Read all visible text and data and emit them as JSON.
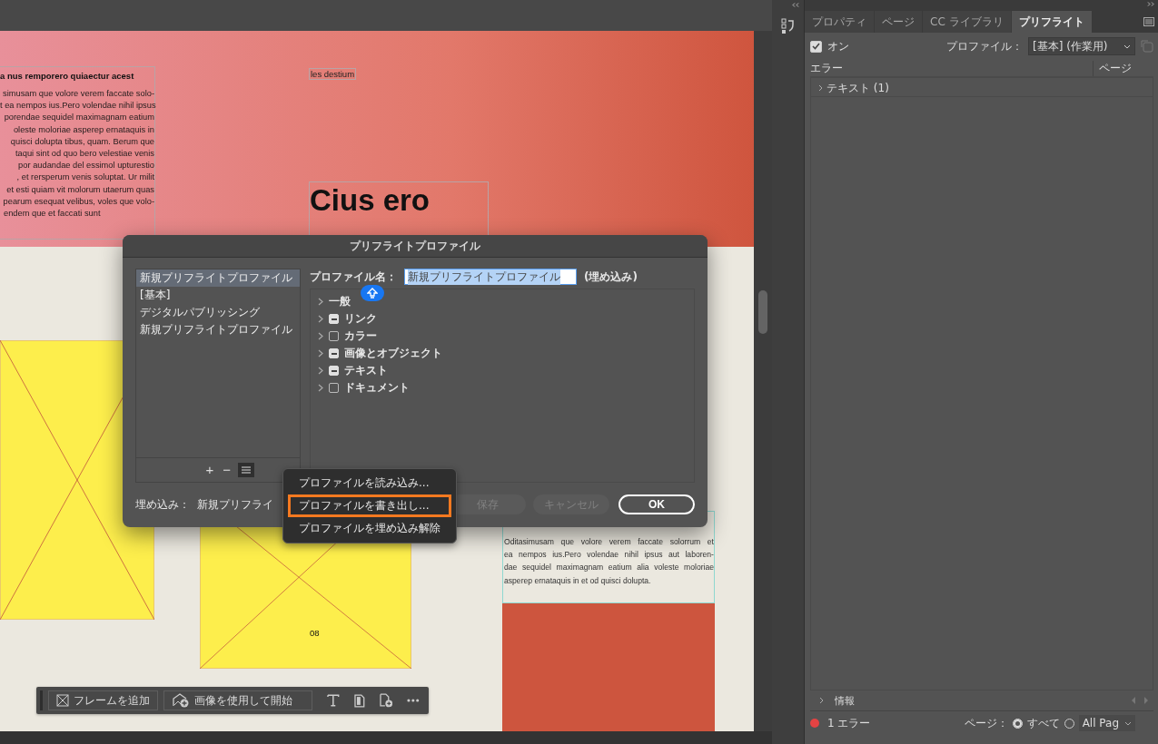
{
  "document": {
    "left_frame": {
      "heading": "a nus remporero quiaectur acest",
      "lines": [
        "simusam que volore verem faccate solo-",
        "t ea nempos ius.Pero volendae nihil ipsus",
        "porendae sequidel maximagnam eatium",
        "oleste moloriae asperep ernataquis in",
        "quisci dolupta tibus, quam. Berum que",
        "taqui sint od quo bero velestiae venis",
        "por audandae del essimol upturestio",
        ", et rersperum venis soluptat. Ur milit",
        "et esti quiam vit molorum utaerum quas",
        "pearum esequat velibus, voles que volo-",
        "endem que et faccati sunt"
      ]
    },
    "small_text": "les destium",
    "headline": "Cius ero",
    "page_number": "08",
    "right_frame": {
      "lines": [
        "Oditasimusam que volore verem faccate solorrum et",
        "ea nempos ius.Pero volendae nihil ipsus aut laboren-",
        "dae sequidel maximagnam eatium alia voleste moloriae",
        "asperep ernataquis in et od quisci dolupta."
      ]
    }
  },
  "toolbar": {
    "buttons": [
      {
        "kind": "frame",
        "label": "フレームを追加"
      },
      {
        "kind": "image",
        "label": "画像を使用して開始"
      }
    ],
    "tools": [
      {
        "kind": "text"
      },
      {
        "kind": "page"
      },
      {
        "kind": "add-page"
      },
      {
        "kind": "more"
      }
    ]
  },
  "dialog": {
    "title": "プリフライトプロファイル",
    "profiles": [
      {
        "label": "新規プリフライトプロファイル",
        "selected": true
      },
      {
        "label": "[基本]",
        "selected": false
      },
      {
        "label": "デジタルパブリッシング",
        "selected": false
      },
      {
        "label": "新規プリフライトプロファイル",
        "selected": false
      }
    ],
    "name_label": "プロファイル名：",
    "name_value": "新規プリフライトプロファイル",
    "name_note": "(埋め込み)",
    "categories": [
      {
        "kind": "plain",
        "label": "一般",
        "expanded": false
      },
      {
        "kind": "check",
        "label": "リンク",
        "mixed": true,
        "expanded": false
      },
      {
        "kind": "check",
        "label": "カラー",
        "mixed": false,
        "expanded": false
      },
      {
        "kind": "check",
        "label": "画像とオブジェクト",
        "mixed": true,
        "expanded": false
      },
      {
        "kind": "check",
        "label": "テキスト",
        "mixed": true,
        "expanded": false
      },
      {
        "kind": "check",
        "label": "ドキュメント",
        "mixed": false,
        "expanded": false
      }
    ],
    "list_tools": [
      {
        "kind": "add",
        "label": "+"
      },
      {
        "kind": "remove",
        "label": "−"
      },
      {
        "kind": "menu"
      }
    ],
    "embed_label": "埋め込み：",
    "embed_value": "新規プリフライ",
    "buttons": [
      {
        "kind": "secondary",
        "label": "保存",
        "disabled": true
      },
      {
        "kind": "secondary",
        "label": "キャンセル",
        "disabled": true
      },
      {
        "kind": "primary",
        "label": "OK",
        "disabled": false
      }
    ],
    "menu": [
      {
        "label": "プロファイルを読み込み...",
        "selected": false
      },
      {
        "label": "プロファイルを書き出し...",
        "selected": true
      },
      {
        "label": "プロファイルを埋め込み解除",
        "selected": false
      }
    ]
  },
  "panel": {
    "tabs": [
      {
        "label": "プロパティ",
        "selected": false
      },
      {
        "label": "ページ",
        "selected": false
      },
      {
        "label": "CC ライブラリ",
        "selected": false
      },
      {
        "label": "プリフライト",
        "selected": true
      }
    ],
    "on": {
      "label": "オン",
      "checked": true
    },
    "profile_label": "プロファイル：",
    "profile_value": "[基本] (作業用)",
    "columns": [
      "エラー",
      "ページ"
    ],
    "results": [
      {
        "label": "テキスト (1)",
        "expanded": false
      }
    ],
    "info": {
      "label": "情報",
      "expanded": false
    },
    "status": {
      "label": "1 エラー"
    },
    "page_label": "ページ：",
    "page_options": [
      {
        "label": "すべて",
        "selected": true
      },
      {
        "label": "All Pag",
        "selected": false
      }
    ]
  }
}
